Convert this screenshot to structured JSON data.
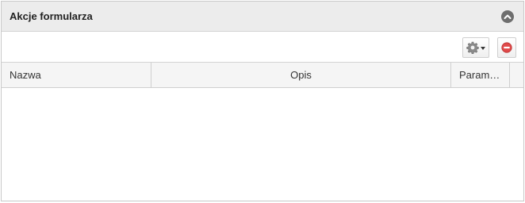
{
  "panel": {
    "title": "Akcje formularza"
  },
  "toolbar": {
    "settings_icon": "gear-icon",
    "delete_icon": "minus-circle-icon"
  },
  "grid": {
    "columns": [
      "Nazwa",
      "Opis",
      "Param…"
    ],
    "rows": []
  },
  "colors": {
    "header_bg": "#ececec",
    "border": "#c9c9c9",
    "delete_red": "#e04a4a",
    "collapse_gray": "#6e6e6e"
  }
}
